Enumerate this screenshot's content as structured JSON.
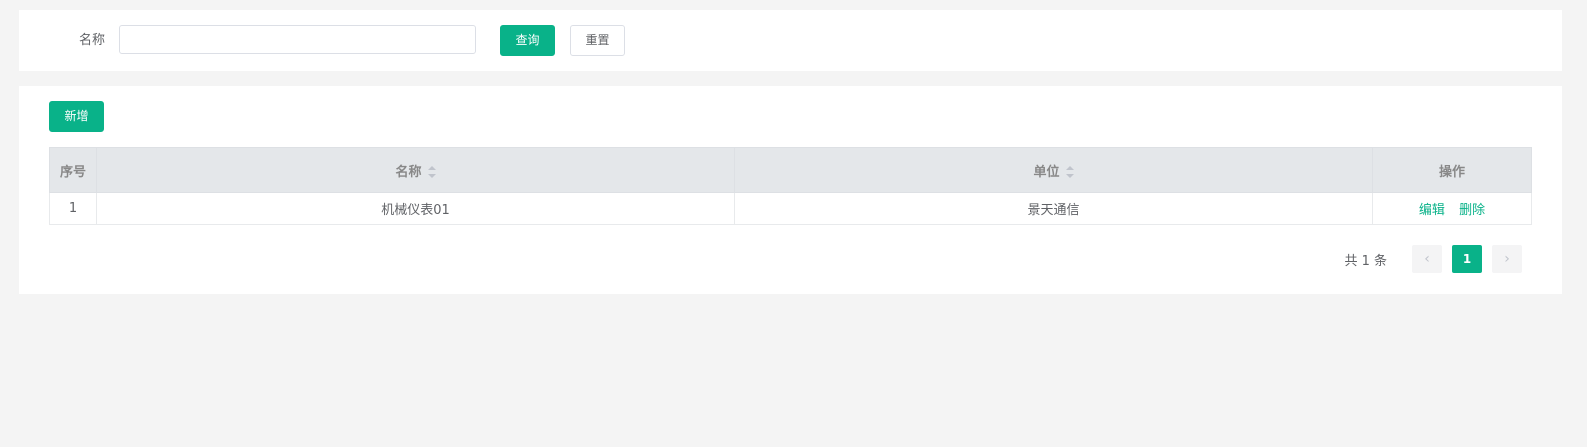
{
  "search": {
    "name_label": "名称",
    "name_value": "",
    "name_placeholder": "",
    "query_label": "查询",
    "reset_label": "重置"
  },
  "toolbar": {
    "add_label": "新增"
  },
  "table": {
    "columns": [
      "序号",
      "名称",
      "单位",
      "操作"
    ],
    "rows": [
      {
        "index": "1",
        "name": "机械仪表01",
        "unit": "景天通信",
        "actions": [
          "编辑",
          "删除"
        ]
      }
    ]
  },
  "pagination": {
    "total_text": "共 1 条",
    "current_page": "1",
    "prev_icon": "‹",
    "next_icon": "›"
  },
  "colors": {
    "primary": "#09b289",
    "background": "#f4f4f4",
    "header_bg": "#e4e7ea"
  }
}
